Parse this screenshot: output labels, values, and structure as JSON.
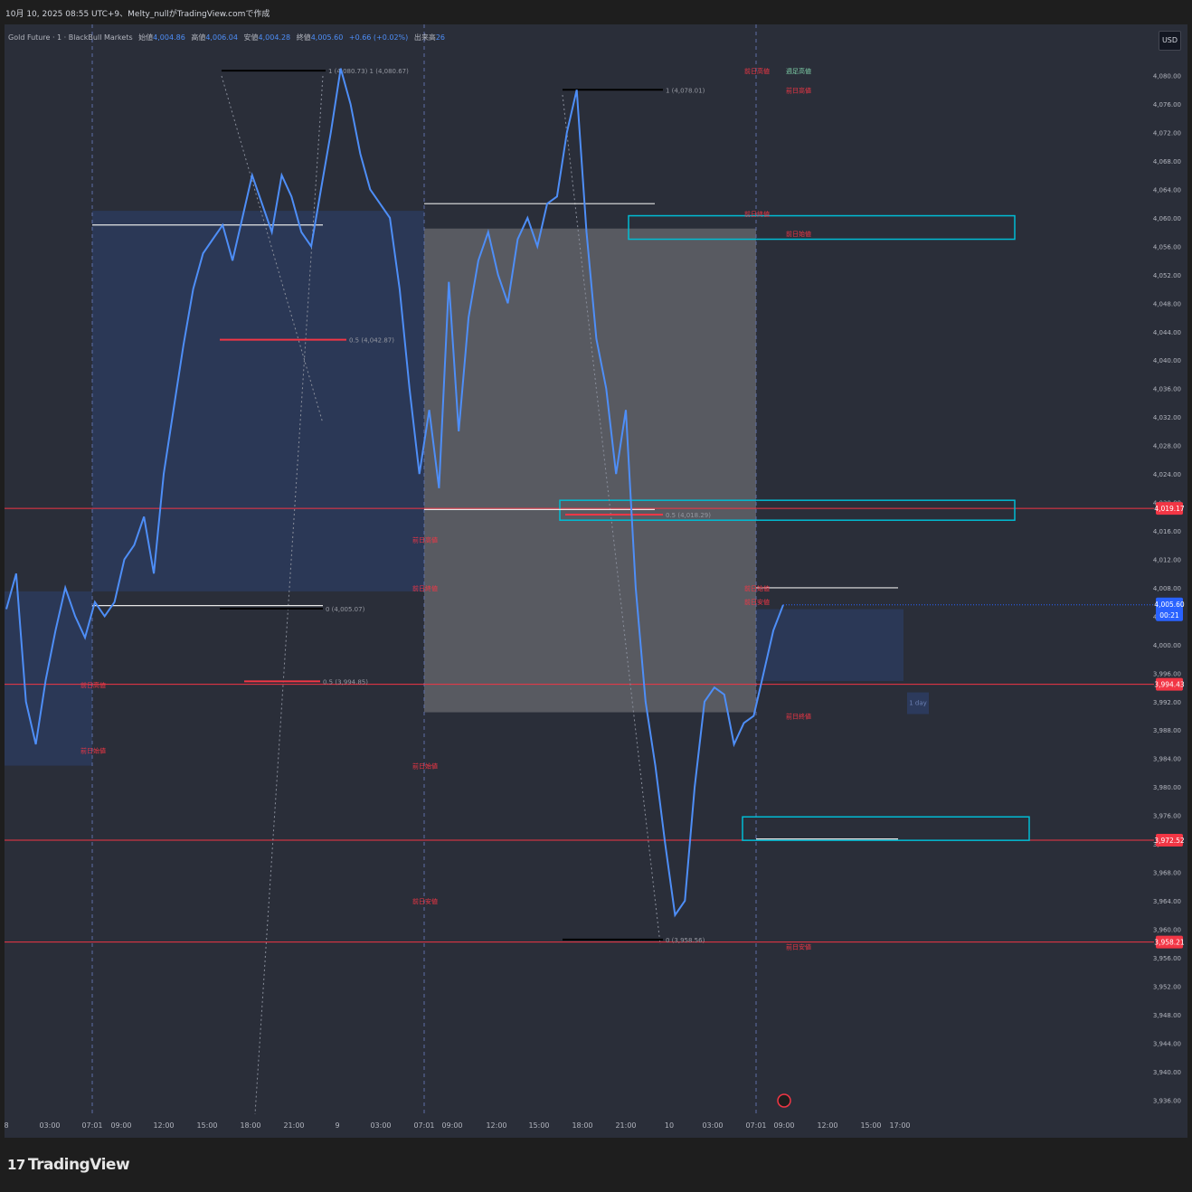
{
  "header": {
    "caption": "10月 10, 2025 08:55 UTC+9、Melty_nullがTradingView.comで作成"
  },
  "legend": {
    "symbol": "Gold Future · 1 · BlackBull Markets",
    "open_label": "始値",
    "open": "4,004.86",
    "high_label": "高値",
    "high": "4,006.04",
    "low_label": "安値",
    "low": "4,004.28",
    "close_label": "終値",
    "close": "4,005.60",
    "change": "+0.66 (+0.02%)",
    "volume_label": "出来高",
    "volume": "26"
  },
  "currency": "USD",
  "brand": {
    "icon": "tradingview-logo-icon",
    "name": "TradingView"
  },
  "colors": {
    "background": "#2a2e39",
    "candle": "#4e8ef7",
    "red_line": "#f23645",
    "cyan_box": "#00bcd4",
    "price_tag": "#2962ff",
    "range_box_blue": "#2c3a5c",
    "range_box_gray": "#5d5f66"
  },
  "chart_data": {
    "type": "line",
    "title": "",
    "xlabel": "",
    "ylabel": "",
    "ylim": [
      3934,
      4083
    ],
    "yticks": [
      "3,936.00",
      "3,940.00",
      "3,944.00",
      "3,948.00",
      "3,952.00",
      "3,956.00",
      "3,960.00",
      "3,964.00",
      "3,968.00",
      "3,972.00",
      "3,976.00",
      "3,980.00",
      "3,984.00",
      "3,988.00",
      "3,992.00",
      "3,996.00",
      "4,000.00",
      "4,004.00",
      "4,008.00",
      "4,012.00",
      "4,016.00",
      "4,020.00",
      "4,024.00",
      "4,028.00",
      "4,032.00",
      "4,036.00",
      "4,040.00",
      "4,044.00",
      "4,048.00",
      "4,052.00",
      "4,056.00",
      "4,060.00",
      "4,064.00",
      "4,068.00",
      "4,072.00",
      "4,076.00",
      "4,080.00"
    ],
    "xticks": [
      "8",
      "03:00",
      "07:01",
      "09:00",
      "12:00",
      "15:00",
      "18:00",
      "21:00",
      "9",
      "03:00",
      "07:01",
      "09:00",
      "12:00",
      "15:00",
      "18:00",
      "21:00",
      "10",
      "03:00",
      "07:01",
      "09:00",
      "12:00",
      "15:00",
      "17:00"
    ],
    "series": [
      {
        "values": [
          4005,
          4010,
          3992,
          3986,
          3995,
          4002,
          4008,
          4004,
          4001,
          4006,
          4004,
          4006,
          4012,
          4014,
          4018,
          4010,
          4024,
          4033,
          4042,
          4050,
          4055,
          4057,
          4059,
          4054,
          4060,
          4066,
          4062,
          4058,
          4066,
          4063,
          4058,
          4056,
          4064,
          4072,
          4081,
          4076,
          4069,
          4064,
          4062,
          4060,
          4050,
          4036,
          4024,
          4033,
          4022,
          4051,
          4030,
          4046,
          4054,
          4058,
          4052,
          4048,
          4057,
          4060,
          4056,
          4062,
          4063,
          4072,
          4078,
          4058,
          4043,
          4036,
          4024,
          4033,
          4008,
          3992,
          3983,
          3972,
          3962,
          3964,
          3980,
          3992,
          3994,
          3993,
          3986,
          3989,
          3990,
          3996,
          4002,
          4005.6
        ]
      }
    ],
    "horizontal_levels": [
      {
        "price": 4019.17,
        "label": "4,019.17"
      },
      {
        "price": 3994.43,
        "label": "3,994.43"
      },
      {
        "price": 3972.52,
        "label": "3,972.52"
      },
      {
        "price": 3958.21,
        "label": "3,958.21"
      }
    ],
    "current_price": {
      "price": 4005.6,
      "label": "4,005.60",
      "countdown": "00:21"
    },
    "fib_labels": [
      {
        "text": "1 (4,080.73) 1 (4,080.67)",
        "price": 4080.7
      },
      {
        "text": "0.5 (4,042.87)",
        "price": 4042.87
      },
      {
        "text": "0 (4,005.07)",
        "price": 4005.07
      },
      {
        "text": "0.5 (3,994.85)",
        "price": 3994.85
      },
      {
        "text": "1 (4,078.01)",
        "price": 4078.01
      },
      {
        "text": "0.5 (4,018.29)",
        "price": 4018.29
      },
      {
        "text": "0 (3,958.56)",
        "price": 3958.56
      }
    ],
    "level_notes": [
      {
        "text": "前日高値",
        "price": 4080.7
      },
      {
        "text": "週足高値",
        "price": 4080.7
      },
      {
        "text": "前日高値",
        "price": 4078.01
      },
      {
        "text": "前日終値",
        "price": 4060.6
      },
      {
        "text": "前日始値",
        "price": 4057.8
      },
      {
        "text": "前日高値",
        "price": 4014.8
      },
      {
        "text": "前日終値",
        "price": 4008.0
      },
      {
        "text": "前日始値",
        "price": 4008.0
      },
      {
        "text": "前日安値",
        "price": 4006.1
      },
      {
        "text": "前日高値",
        "price": 3994.4
      },
      {
        "text": "前日終値",
        "price": 3990.0
      },
      {
        "text": "前日始値",
        "price": 3985.2
      },
      {
        "text": "前日始値",
        "price": 3983.0
      },
      {
        "text": "前日安値",
        "price": 3964.0
      },
      {
        "text": "前日安値",
        "price": 3957.6
      }
    ],
    "time_window_label": "1 day"
  }
}
